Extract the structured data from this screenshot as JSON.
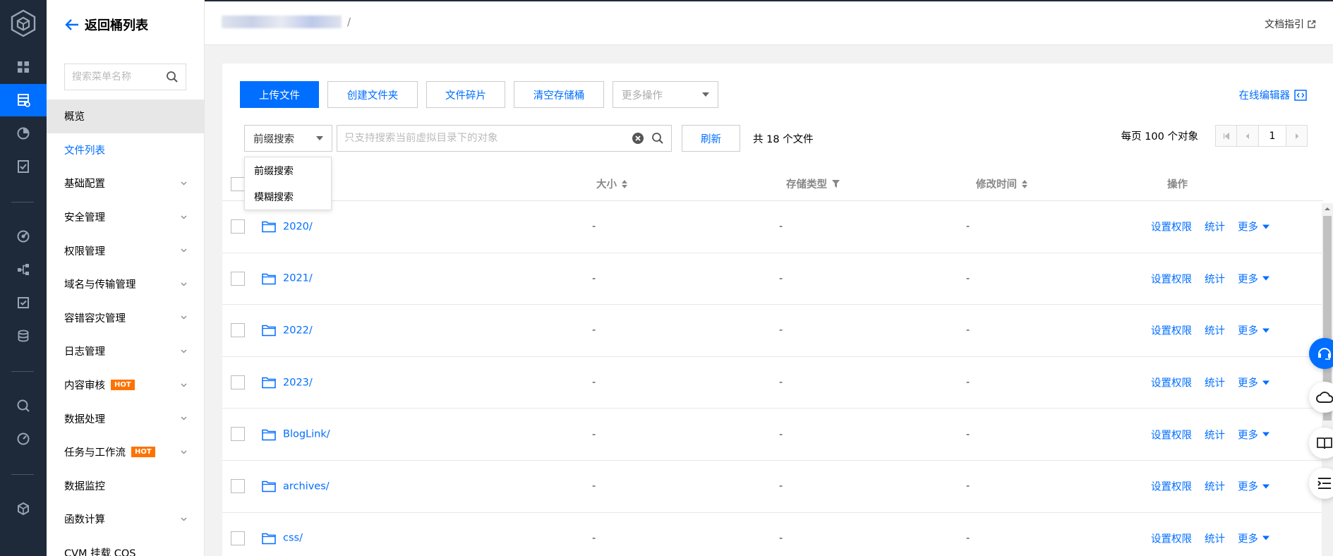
{
  "sidebar": {
    "back_label": "返回桶列表",
    "search_placeholder": "搜索菜单名称",
    "items": [
      {
        "label": "概览"
      },
      {
        "label": "文件列表"
      },
      {
        "label": "基础配置"
      },
      {
        "label": "安全管理"
      },
      {
        "label": "权限管理"
      },
      {
        "label": "域名与传输管理"
      },
      {
        "label": "容错容灾管理"
      },
      {
        "label": "日志管理"
      },
      {
        "label": "内容审核",
        "badge": "HOT"
      },
      {
        "label": "数据处理"
      },
      {
        "label": "任务与工作流",
        "badge": "HOT"
      },
      {
        "label": "数据监控"
      },
      {
        "label": "函数计算"
      },
      {
        "label": "CVM 挂载 COS"
      }
    ]
  },
  "header": {
    "breadcrumb_sep": "/",
    "doc_link": "文档指引"
  },
  "toolbar": {
    "upload": "上传文件",
    "create_folder": "创建文件夹",
    "fragments": "文件碎片",
    "clear_bucket": "清空存储桶",
    "more_ops": "更多操作",
    "online_editor": "在线编辑器"
  },
  "search": {
    "mode": "前缀搜索",
    "placeholder": "只支持搜索当前虚拟目录下的对象",
    "refresh": "刷新",
    "total": "共 18 个文件",
    "dropdown_options": [
      "前缀搜索",
      "模糊搜索"
    ]
  },
  "pager": {
    "per_page": "每页 100 个对象",
    "page": "1"
  },
  "table": {
    "headers": {
      "size": "大小",
      "storage": "存储类型",
      "modified": "修改时间",
      "actions": "操作"
    },
    "rows": [
      {
        "name": "2020/",
        "size": "-",
        "storage": "-",
        "modified": "-"
      },
      {
        "name": "2021/",
        "size": "-",
        "storage": "-",
        "modified": "-"
      },
      {
        "name": "2022/",
        "size": "-",
        "storage": "-",
        "modified": "-"
      },
      {
        "name": "2023/",
        "size": "-",
        "storage": "-",
        "modified": "-"
      },
      {
        "name": "BlogLink/",
        "size": "-",
        "storage": "-",
        "modified": "-"
      },
      {
        "name": "archives/",
        "size": "-",
        "storage": "-",
        "modified": "-"
      },
      {
        "name": "css/",
        "size": "-",
        "storage": "-",
        "modified": "-"
      }
    ],
    "actions": {
      "permission": "设置权限",
      "stats": "统计",
      "more": "更多"
    }
  },
  "colors": {
    "accent": "#006eff",
    "rail": "#1e2a3a",
    "hot": "#ff7200"
  }
}
